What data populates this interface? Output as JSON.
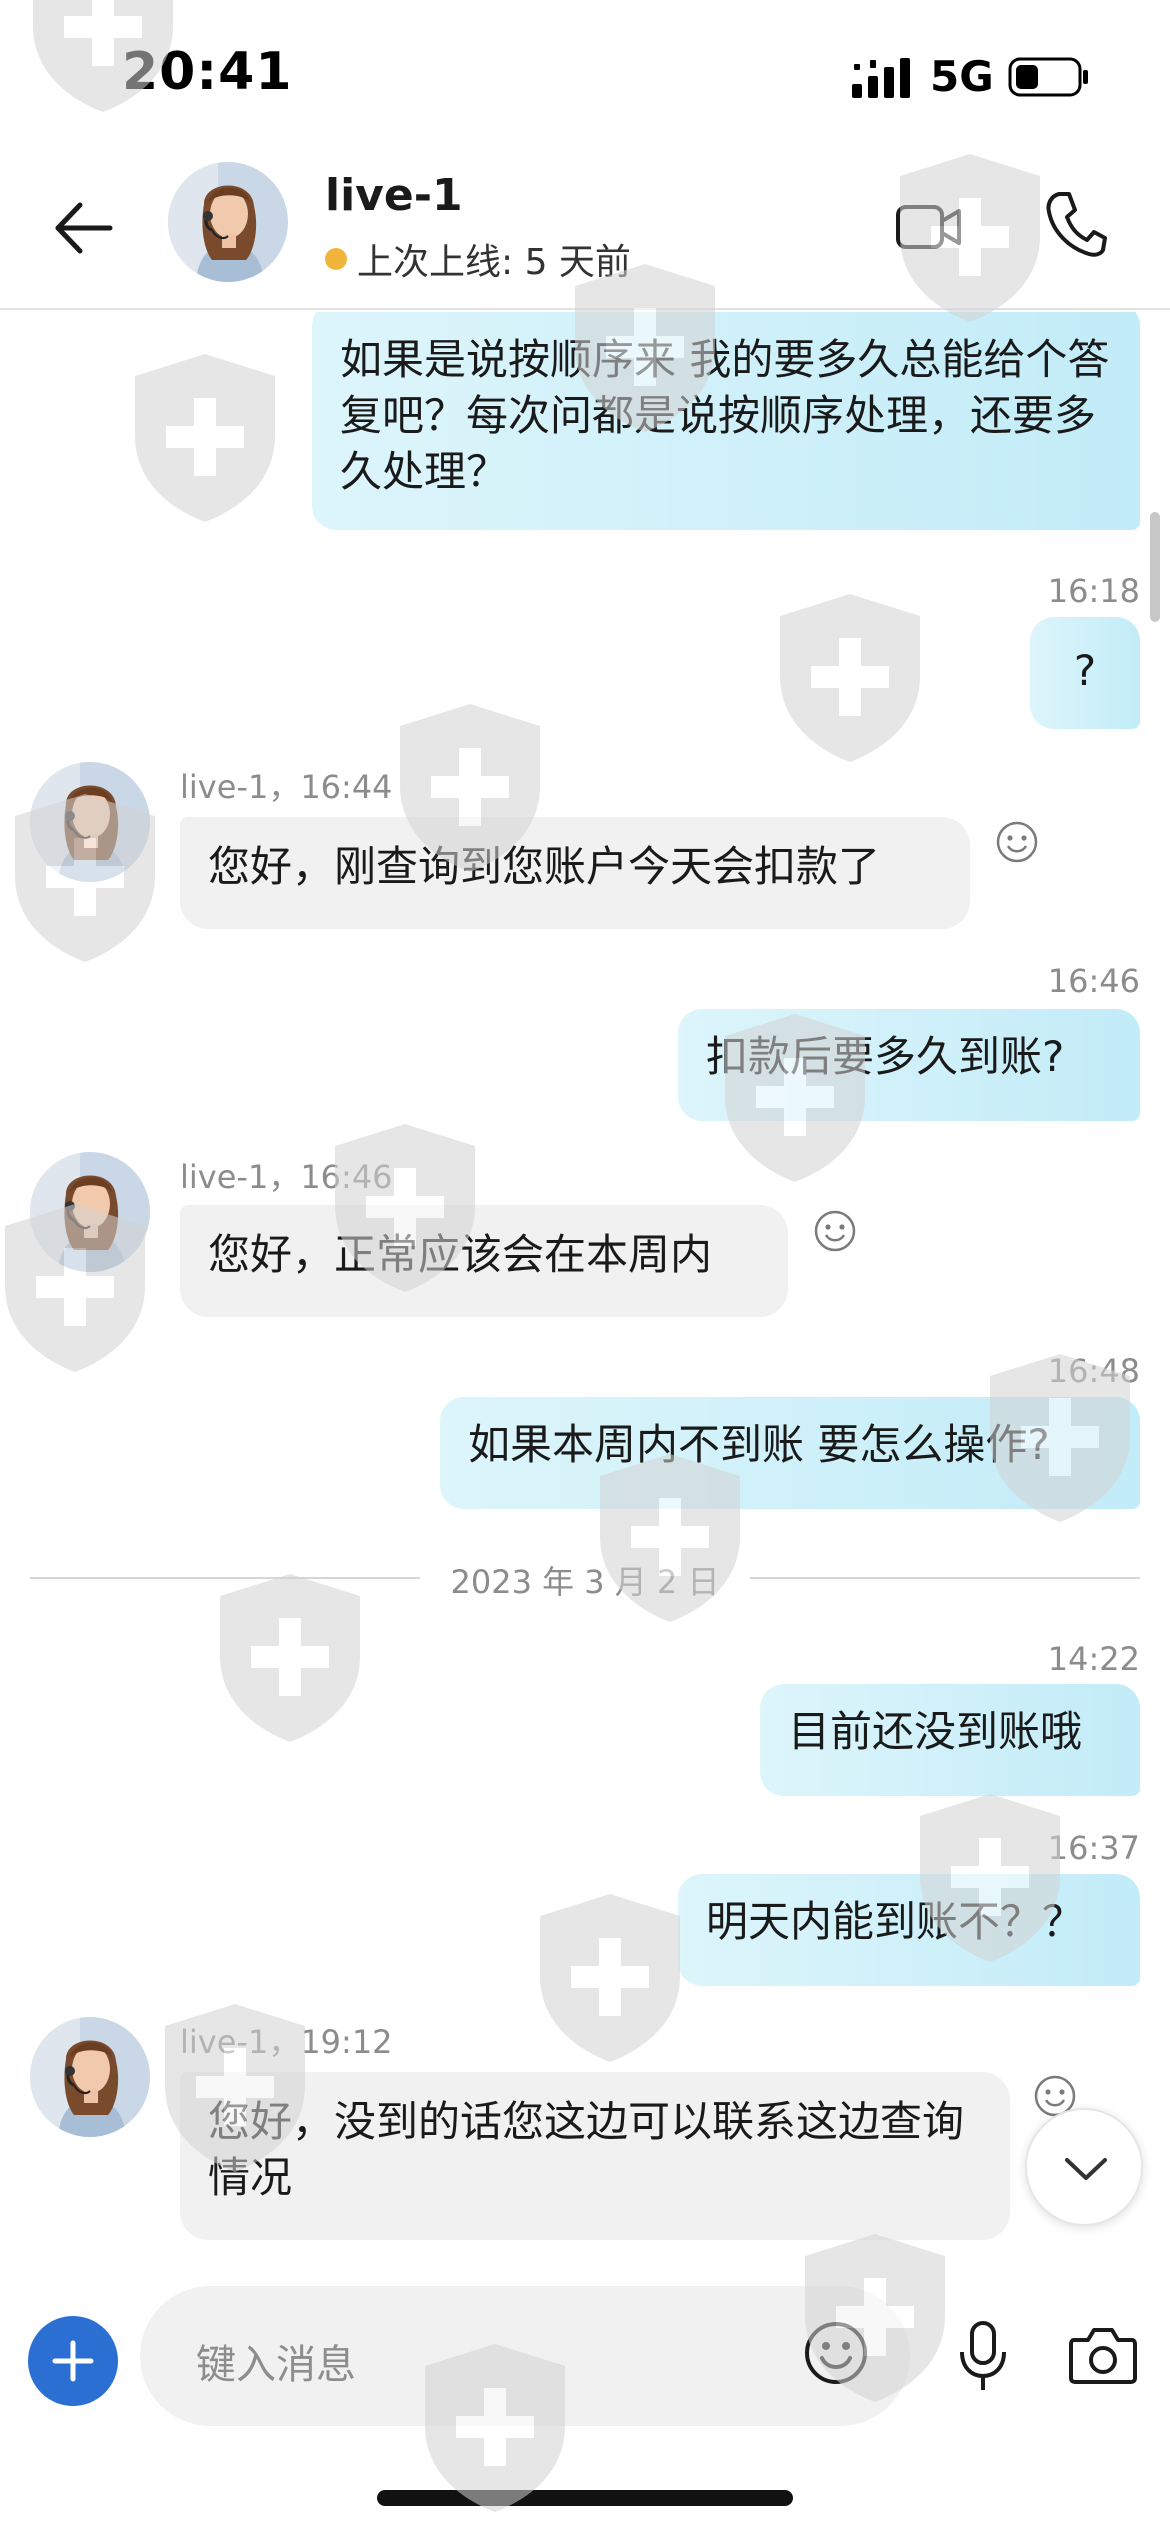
{
  "status_bar": {
    "time": "20:41",
    "network": "5G"
  },
  "header": {
    "contact_name": "live-1",
    "presence_text": "上次上线: 5 天前"
  },
  "messages": [
    {
      "type": "outgoing",
      "text": "如果是说按顺序来 我的要多久总能给个答复吧？每次问都是说按顺序处理，还要多久处理？"
    },
    {
      "type": "outgoing",
      "time": "16:18",
      "text": "?"
    },
    {
      "type": "incoming",
      "meta": "live-1，16:44",
      "text": "您好，刚查询到您账户今天会扣款了"
    },
    {
      "type": "outgoing",
      "time": "16:46",
      "text": "扣款后要多久到账?"
    },
    {
      "type": "incoming",
      "meta": "live-1，16:46",
      "text": "您好，正常应该会在本周内"
    },
    {
      "type": "outgoing",
      "time": "16:48",
      "text": "如果本周内不到账 要怎么操作?"
    },
    {
      "type": "date",
      "text": "2023 年 3 月 2 日"
    },
    {
      "type": "outgoing",
      "time": "14:22",
      "text": "目前还没到账哦"
    },
    {
      "type": "outgoing",
      "time": "16:37",
      "text": "明天内能到账不？？"
    },
    {
      "type": "incoming",
      "meta": "live-1，19:12",
      "text": "您好，没到的话您这边可以联系这边查询情况"
    }
  ],
  "composer": {
    "placeholder": "键入消息"
  },
  "icons": {
    "back": "arrow-left-icon",
    "video": "video-camera-icon",
    "call": "phone-icon",
    "add": "plus-icon",
    "emoji": "smiley-icon",
    "mic": "microphone-icon",
    "camera": "camera-icon",
    "scroll_down": "chevron-down-icon"
  },
  "colors": {
    "outgoing_bubble": "#c2ecf8",
    "incoming_bubble": "#f1f1f1",
    "accent": "#2c6fd2",
    "presence_dot": "#f2b53c"
  }
}
